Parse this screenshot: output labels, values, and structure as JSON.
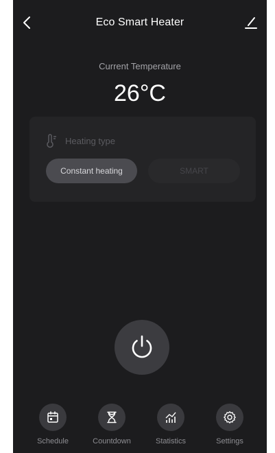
{
  "header": {
    "title": "Eco Smart Heater",
    "back_icon": "chevron-left-icon",
    "edit_icon": "pencil-icon"
  },
  "temperature": {
    "label": "Current Temperature",
    "value": "26°C"
  },
  "heating": {
    "label": "Heating type",
    "icon": "thermometer-icon",
    "options": [
      {
        "label": "Constant heating",
        "selected": true
      },
      {
        "label": "SMART",
        "selected": false
      }
    ]
  },
  "power": {
    "icon": "power-icon",
    "state": "off"
  },
  "bottom_nav": {
    "items": [
      {
        "label": "Schedule",
        "icon": "calendar-icon"
      },
      {
        "label": "Countdown",
        "icon": "hourglass-icon"
      },
      {
        "label": "Statistics",
        "icon": "chart-icon"
      },
      {
        "label": "Settings",
        "icon": "gear-icon"
      }
    ]
  },
  "colors": {
    "background": "#1c1c1e",
    "card": "#242426",
    "accent_button": "#4b4b50",
    "text_primary": "#ffffff",
    "text_secondary": "#a3a3a8"
  }
}
